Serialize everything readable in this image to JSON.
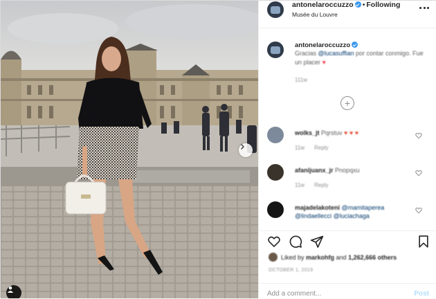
{
  "header": {
    "username": "antonelaroccuzzo",
    "follow_label": "Following",
    "location": "Musée du Louvre",
    "separator": "•"
  },
  "caption": {
    "username": "antonelaroccuzzo",
    "mention": "@lucasuffian",
    "text_before": "Gracias ",
    "text_after": " por contar conmigo. Fue un placer ",
    "heart": "♥",
    "time": "111w"
  },
  "load_more_symbol": "+",
  "comments": [
    {
      "username": "wolks_jt",
      "text": "Pqrstuv ",
      "emoji": "♥ ♥ ♥",
      "time": "11w",
      "reply_label": "Reply"
    },
    {
      "username": "afanijuanx_jr",
      "text": "Pnopqxu",
      "emoji": "",
      "time": "11w",
      "reply_label": "Reply"
    },
    {
      "username": "majadelakoteni",
      "text": "@mamitaperea @lindaellecci @luciachaga",
      "emoji": "",
      "time": "",
      "reply_label": ""
    }
  ],
  "likes": {
    "text_prefix": "Liked by ",
    "liker": "markohfg",
    "text_middle": " and ",
    "count": "1,262,666 others"
  },
  "post_date": "OCTOBER 1, 2019",
  "add_comment": {
    "placeholder": "Add a comment...",
    "post_label": "Post"
  },
  "colors": {
    "verified": "#3897f0",
    "link": "#00376b",
    "heart": "#ed4956",
    "post_disabled": "#b2dffc"
  }
}
